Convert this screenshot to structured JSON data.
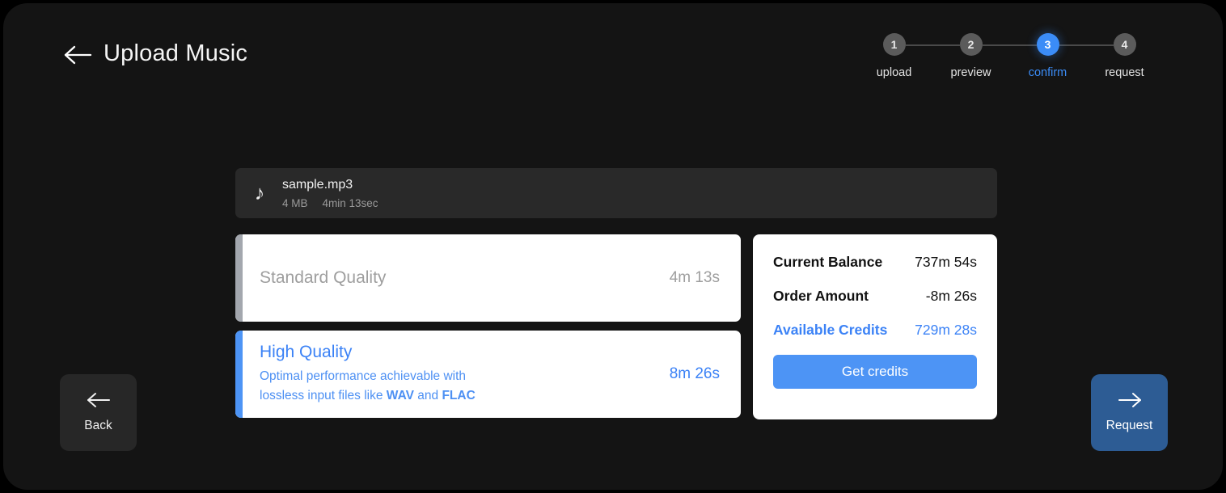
{
  "header": {
    "back_icon": "arrow-left-icon",
    "title": "Upload Music"
  },
  "stepper": {
    "steps": [
      {
        "number": "1",
        "label": "upload",
        "active": false
      },
      {
        "number": "2",
        "label": "preview",
        "active": false
      },
      {
        "number": "3",
        "label": "confirm",
        "active": true
      },
      {
        "number": "4",
        "label": "request",
        "active": false
      }
    ]
  },
  "file_card": {
    "icon": "music-note-icon",
    "icon_glyph": "♪",
    "name": "sample.mp3",
    "size": "4 MB",
    "duration": "4min 13sec"
  },
  "quality_options": [
    {
      "id": "standard",
      "title": "Standard Quality",
      "description": "",
      "duration": "4m 13s",
      "selected": false,
      "accent_color": "#a3a7ae"
    },
    {
      "id": "high",
      "title": "High Quality",
      "description_part1": "Optimal performance achievable with lossless input files like ",
      "description_bold1": "WAV",
      "description_part2": " and ",
      "description_bold2": "FLAC",
      "duration": "8m 26s",
      "selected": true,
      "accent_color": "#4d94f5"
    }
  ],
  "balance": {
    "rows": [
      {
        "label": "Current Balance",
        "value": "737m 54s"
      },
      {
        "label": "Order Amount",
        "value": "-8m 26s"
      },
      {
        "label": "Available Credits",
        "value": "729m 28s"
      }
    ],
    "get_credits_label": "Get credits"
  },
  "navigation": {
    "back": {
      "label": "Back",
      "icon": "arrow-left-icon"
    },
    "request": {
      "label": "Request",
      "icon": "arrow-right-icon"
    }
  },
  "colors": {
    "accent_blue": "#3b82f6",
    "button_blue": "#4d94f5",
    "request_blue": "#2d5c94",
    "page_bg": "#141414",
    "card_bg": "#292929"
  }
}
